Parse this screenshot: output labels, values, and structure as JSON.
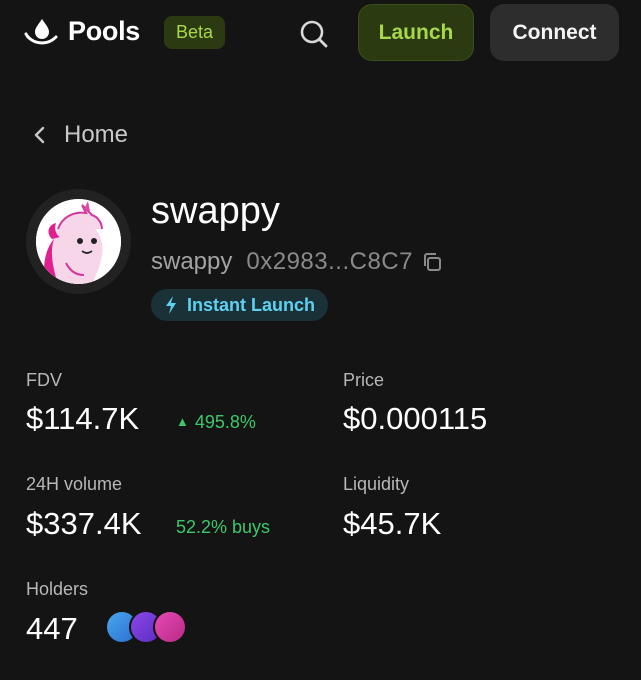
{
  "header": {
    "logo_text": "Pools",
    "beta_label": "Beta",
    "launch_label": "Launch",
    "connect_label": "Connect",
    "icons": {
      "logo": "drop-on-hand-icon",
      "search": "search-icon"
    }
  },
  "breadcrumb": {
    "label": "Home",
    "icon": "chevron-left-icon"
  },
  "token": {
    "name": "swappy",
    "symbol": "swappy",
    "address": "0x2983...C8C7",
    "badge": "Instant Launch",
    "icons": {
      "copy": "copy-icon",
      "badge": "lightning-bolt-icon",
      "avatar": "unicorn-avatar"
    }
  },
  "stats": {
    "fdv": {
      "label": "FDV",
      "value": "$114.7K",
      "change": "495.8%",
      "change_direction": "up"
    },
    "price": {
      "label": "Price",
      "value": "$0.000115"
    },
    "volume": {
      "label": "24H volume",
      "value": "$337.4K",
      "buys": "52.2% buys"
    },
    "liquidity": {
      "label": "Liquidity",
      "value": "$45.7K"
    },
    "holders": {
      "label": "Holders",
      "value": "447"
    }
  },
  "colors": {
    "background": "#141414",
    "accent_green": "#a6d84a",
    "accent_green_bg": "#2c3a12",
    "positive": "#3cc86a",
    "badge_cyan": "#5fd1f0",
    "holder_dots": [
      "#3a8ee0",
      "#7a3cdc",
      "#d63aa6"
    ]
  }
}
